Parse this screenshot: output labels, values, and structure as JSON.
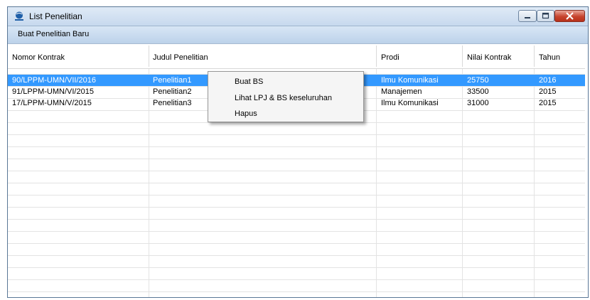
{
  "window": {
    "title": "List Penelitian",
    "icon": "app-globe-icon"
  },
  "toolbar": {
    "new_research_label": "Buat Penelitian Baru"
  },
  "table": {
    "columns": [
      "Nomor Kontrak",
      "Judul Penelitian",
      "Prodi",
      "Nilai Kontrak",
      "Tahun"
    ],
    "rows": [
      [
        "90/LPPM-UMN/VII/2016",
        "Penelitian1",
        "Ilmu Komunikasi",
        "25750",
        "2016"
      ],
      [
        "91/LPPM-UMN/VI/2015",
        "Penelitian2",
        "Manajemen",
        "33500",
        "2015"
      ],
      [
        "17/LPPM-UMN/V/2015",
        "Penelitian3",
        "Ilmu Komunikasi",
        "31000",
        "2015"
      ]
    ],
    "selected_row": 0
  },
  "context_menu": {
    "items": [
      "Buat BS",
      "Lihat LPJ & BS keseluruhan",
      "Hapus"
    ]
  },
  "colors": {
    "selection": "#3399ff",
    "titlebar": "#c7d9ee",
    "close_button": "#c7442e"
  }
}
